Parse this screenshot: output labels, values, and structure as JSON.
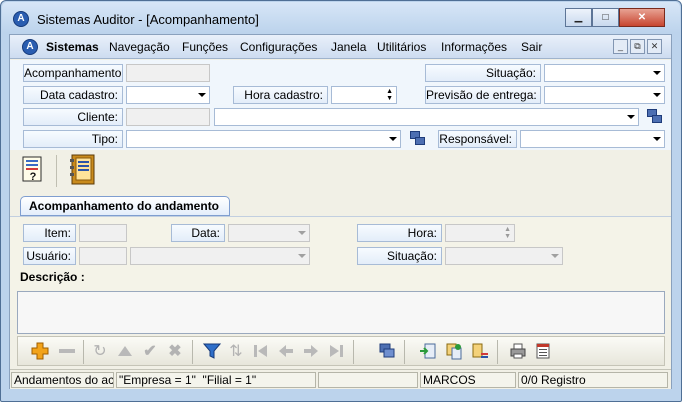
{
  "window": {
    "title": "Sistemas Auditor - [Acompanhamento]",
    "app_icon_letter": "A",
    "minimize": "▁",
    "maximize": "□",
    "close": "✕"
  },
  "menu": {
    "brand": "Sistemas",
    "items": [
      "Navegação",
      "Funções",
      "Configurações",
      "Janela",
      "Utilitários",
      "Informações",
      "Sair"
    ],
    "mdi": [
      "_",
      "⧉",
      "✕"
    ]
  },
  "form": {
    "acompanhamento_label": "Acompanhamento:",
    "situacao_label": "Situação:",
    "data_cadastro_label": "Data cadastro:",
    "hora_cadastro_label": "Hora cadastro:",
    "previsao_label": "Previsão de entrega:",
    "cliente_label": "Cliente:",
    "tipo_label": "Tipo:",
    "responsavel_label": "Responsável:"
  },
  "section": {
    "tab_label": "Acompanhamento do andamento"
  },
  "detail": {
    "item_label": "Item:",
    "data_label": "Data:",
    "hora_label": "Hora:",
    "usuario_label": "Usuário:",
    "situacao_label": "Situação:",
    "descricao_label": "Descrição :"
  },
  "status": {
    "panel1": "Andamentos do ac",
    "panel2": "\"Empresa = 1\"  \"Filial = 1\"",
    "panel3": "",
    "panel4": "MARCOS",
    "panel5": "0/0 Registro"
  },
  "colors": {
    "accent": "#2a5db0",
    "add": "#f2a31a",
    "filter": "#2f6fc9"
  },
  "icons": [
    "info-help-icon",
    "notebook-icon",
    "add-icon",
    "remove-icon",
    "refresh-icon",
    "up-icon",
    "confirm-icon",
    "cancel-icon",
    "filter-icon",
    "sort-icon",
    "first-icon",
    "prior-icon",
    "next-icon",
    "last-icon",
    "lookup-icon",
    "import-icon",
    "transfer-icon",
    "list-icon",
    "print-icon",
    "report-icon"
  ]
}
